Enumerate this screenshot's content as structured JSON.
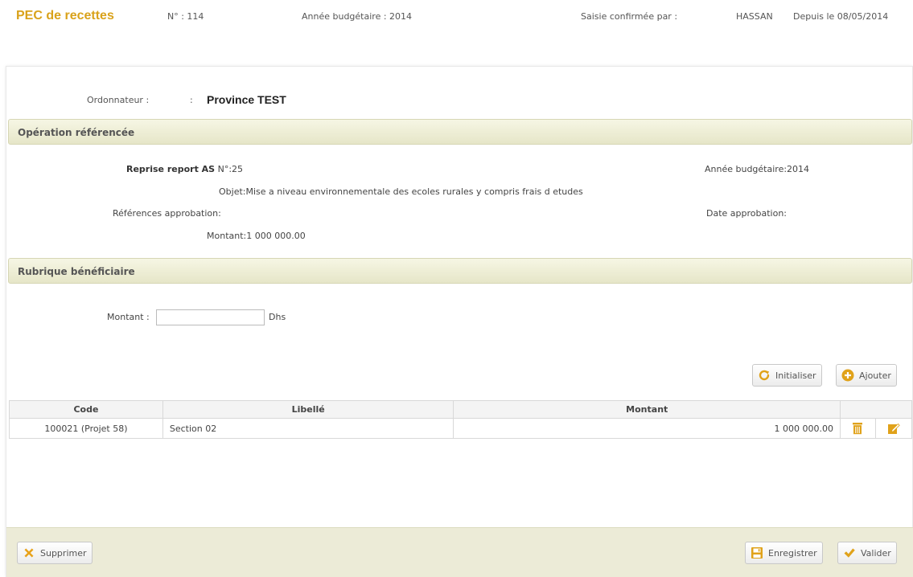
{
  "header": {
    "title": "PEC de recettes",
    "numero": "N° : 114",
    "annee": "Année budgétaire : 2014",
    "saisie_label": "Saisie confirmée par :",
    "saisie_user": "HASSAN",
    "saisie_date": "Depuis le 08/05/2014"
  },
  "ordonnateur": {
    "label": "Ordonnateur :",
    "sep": ":",
    "value": "Province TEST"
  },
  "operation": {
    "section_title": "Opération référencée",
    "type": "Reprise report AS",
    "numero": "N°:25",
    "annee": "Année budgétaire:2014",
    "objet": "Objet:Mise a niveau environnementale des ecoles rurales y compris frais d etudes",
    "references_label": "Références approbation:",
    "date_label": "Date approbation:",
    "montant": "Montant:1 000 000.00"
  },
  "rubrique": {
    "section_title": "Rubrique bénéficiaire",
    "montant_label": "Montant :",
    "montant_value": "",
    "unit": "Dhs"
  },
  "actions": {
    "initialiser": "Initialiser",
    "ajouter": "Ajouter"
  },
  "table": {
    "columns": [
      "Code",
      "Libellé",
      "Montant",
      ""
    ],
    "rows": [
      {
        "code": "100021 (Projet 58)",
        "libelle": "Section 02",
        "montant": "1 000 000.00"
      }
    ]
  },
  "footer": {
    "supprimer": "Supprimer",
    "enregistrer": "Enregistrer",
    "valider": "Valider"
  },
  "icons": {
    "refresh": "refresh-icon",
    "add": "plus-circle-icon",
    "trash": "trash-icon",
    "edit": "edit-icon",
    "delete": "x-icon",
    "save": "save-icon",
    "check": "check-icon"
  },
  "colors": {
    "accent": "#d9a21b",
    "footer_bg": "#ecebd7",
    "delete_x": "#e8a21a"
  }
}
